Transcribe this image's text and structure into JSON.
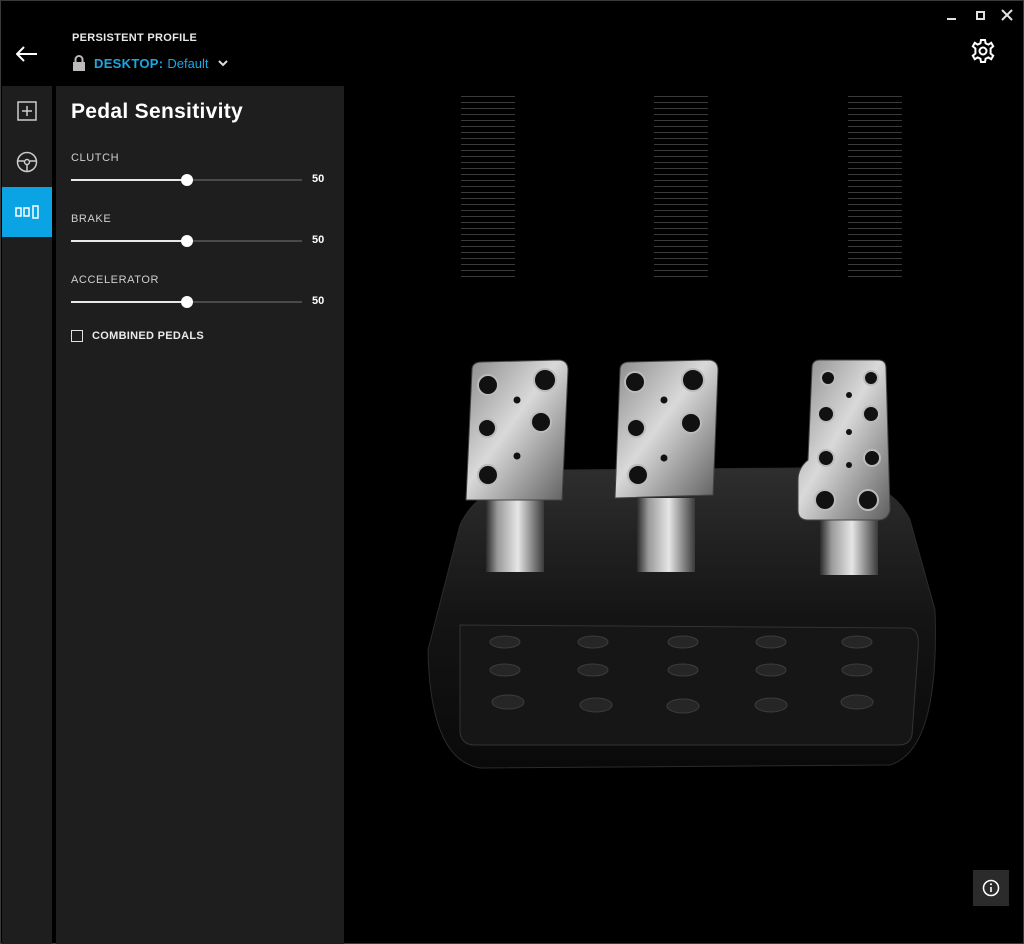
{
  "window": {
    "controls": [
      "minimize",
      "maximize",
      "close"
    ]
  },
  "header": {
    "profile_label": "PERSISTENT PROFILE",
    "device": "DESKTOP:",
    "profile_name": "Default",
    "icons": {
      "back": "back-arrow-icon",
      "lock": "lock-icon",
      "dropdown": "chevron-down-icon",
      "settings": "gear-icon"
    }
  },
  "rail": {
    "items": [
      {
        "name": "add-icon",
        "active": false
      },
      {
        "name": "steering-wheel-icon",
        "active": false
      },
      {
        "name": "pedals-icon",
        "active": true
      }
    ]
  },
  "panel": {
    "title": "Pedal Sensitivity",
    "sliders": [
      {
        "label": "CLUTCH",
        "value": "50"
      },
      {
        "label": "BRAKE",
        "value": "50"
      },
      {
        "label": "ACCELERATOR",
        "value": "50"
      }
    ],
    "combined_pedals": {
      "label": "COMBINED PEDALS",
      "checked": false
    }
  },
  "meters": [
    {
      "name": "clutch-meter",
      "level": 0
    },
    {
      "name": "brake-meter",
      "level": 0
    },
    {
      "name": "accelerator-meter",
      "level": 0
    }
  ],
  "colors": {
    "accent": "#0aa3e4",
    "panel": "#1e1e1e",
    "background": "#000000"
  },
  "info_button": {
    "icon": "info-icon"
  }
}
